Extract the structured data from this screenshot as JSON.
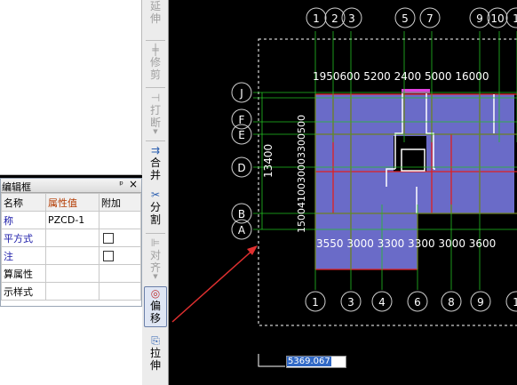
{
  "property_panel": {
    "title": "编辑框",
    "pin": "ᵖ",
    "close": "×",
    "headers": [
      "名称",
      "属性值",
      "附加"
    ],
    "rows": [
      {
        "name": "称",
        "value": "PZCD-1",
        "check": false,
        "blue": true
      },
      {
        "name": "平方式",
        "value": "",
        "check": true,
        "blue": true
      },
      {
        "name": "注",
        "value": "",
        "check": true,
        "blue": true
      },
      {
        "name": "算属性",
        "value": "",
        "check": false,
        "blue": false
      },
      {
        "name": "示样式",
        "value": "",
        "check": false,
        "blue": false
      }
    ]
  },
  "toolbar": {
    "items": [
      {
        "key": "extend",
        "label": "延伸",
        "icon": "⌐",
        "enabled": false
      },
      {
        "key": "trim",
        "label": "修剪",
        "icon": "╪",
        "enabled": false
      },
      {
        "key": "break",
        "label": "打断",
        "icon": "⊣",
        "enabled": false
      },
      {
        "key": "merge",
        "label": "合并",
        "icon": "⇉",
        "enabled": true
      },
      {
        "key": "split",
        "label": "分割",
        "icon": "✂",
        "enabled": true
      },
      {
        "key": "align",
        "label": "对齐",
        "icon": "⊫",
        "enabled": false
      },
      {
        "key": "offset",
        "label": "偏移",
        "icon": "◎",
        "enabled": true
      },
      {
        "key": "stretch",
        "label": "拉伸",
        "icon": "⎘",
        "enabled": true
      }
    ]
  },
  "drawing": {
    "top_axes": [
      "1",
      "2",
      "3",
      "5",
      "7",
      "9",
      "10",
      "1"
    ],
    "bottom_axes": [
      "1",
      "3",
      "4",
      "6",
      "8",
      "9",
      "1"
    ],
    "left_axes": [
      "J",
      "F",
      "E",
      "D",
      "B",
      "A"
    ],
    "top_dims": "1950600 5200 2400 5000 16000",
    "bottom_dims": "3550 3000 3300 3300 3000 3600",
    "left_total": "13400",
    "left_dims": "1500410030003300500",
    "coord_value": "5369.067"
  },
  "colors": {
    "background": "#000000",
    "slab_fill": "#6a6bc8",
    "axis": "#22c022",
    "beam": "#e02020",
    "text": "#ffffff",
    "arrow": "#e03030"
  }
}
